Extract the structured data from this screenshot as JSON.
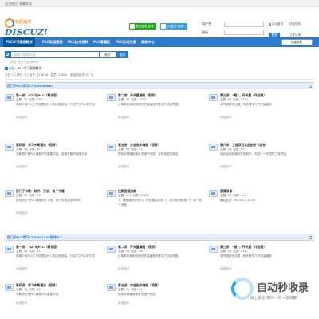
{
  "topbar": {
    "home_link": "设为首页",
    "fav_link": "收藏本站"
  },
  "logo": {
    "name": "社区动力",
    "brand": "DISCUZ!"
  },
  "quick_login": {
    "wechat": "微信登录 登录",
    "qq": "QQ账号 登录"
  },
  "login": {
    "username_label": "用户名",
    "password_label": "密码",
    "auto_login": "自动登录",
    "find_password": "找回密码",
    "login_button": "登录",
    "register": "立即注册"
  },
  "nav": {
    "items": [
      "PLC学习视频教学",
      "PLC实用案例",
      "PLC技术资料",
      "PLC答疑区",
      "PLC论坛交流",
      "帮助中心"
    ],
    "quick_nav": "快捷导航"
  },
  "search": {
    "placeholder": "请输入搜索内容",
    "scope": "帖子",
    "button": "搜索",
    "hot": "热搜: 活动 交友 discuz"
  },
  "breadcrumb": "论坛 › PLC学习视频教学",
  "stats": "今日: 0 | 昨日: 0 | 帖子: 118028 | 会员: 12602 | 欢迎新会员: fu 飞",
  "sections": [
    {
      "title": "西门子PLC学习S7-200/SMART",
      "forums": [
        {
          "name": "第一讲：“以”站PLC（精讲版）",
          "stats": "主题: 32, 帖数: 376",
          "desc": "简单介绍PLC工作原理及PLC的应用领域，介绍学习PLC的方法",
          "mod": "私密板块"
        },
        {
          "name": "第二讲：开关量编程（视频）",
          "stats": "主题: 38, 帖数: 1553",
          "desc": "以简单的案例说明开关量编程的基本方法及思路",
          "mod": "私密板块"
        },
        {
          "name": "第三讲：“看”，开关量（作业题）",
          "stats": "主题: 81, 帖数: 5517",
          "desc": "本节课做作业题，有步骤学习开关量编程",
          "mod": "私密板块"
        },
        {
          "name": "第四讲：学习中断理论（视频）",
          "stats": "主题: 33, 帖数: 31",
          "desc": "中断理论是PLC编程中的重要内容，讲解中断的使用方法",
          "mod": "私密板块"
        },
        {
          "name": "第五讲：步进指令编程（视频）",
          "stats": "主题: 36, 帖数: 47",
          "desc": "把多步骤编程用步进指令完成，让程序更加简洁",
          "mod": "私密板块"
        },
        {
          "name": "第六讲：工程项目实战剖析（综合）",
          "stats": "主题: 33, 帖数: 90",
          "desc": "综合运用前面所学的知识，完成一个完整的工程项目",
          "mod": "私密板块"
        },
        {
          "name": "西门子参数：软件、手册、电子书籍",
          "stats": "主题: 42, 帖数: 491",
          "desc": "提供西门子PLC编程软件下载、用户手册及技术资料",
          "mod": "私密板块"
        },
        {
          "name": "往期答疑指南",
          "stats": "主题: 471, 帖数: 1003",
          "desc": "1、请跟随老师学习，可在课后提问; 2、提问前请搜索; 3、每一帖一问题",
          "mod": ""
        },
        {
          "name": "直播录像",
          "stats": "主题: 37, 帖数: 124",
          "desc": "最后发表: 2024-8-4 13:50",
          "mod": ""
        }
      ]
    },
    {
      "title": "西门子PLC学习S7-300/1200系列PLC",
      "forums": [
        {
          "name": "第一讲：“以”站PLC（精讲版）",
          "stats": "主题: 36, 帖数: 31",
          "desc": "简单介绍PLC工作原理及PLC的应用领域，介绍学习PLC的方法",
          "mod": "私密板块"
        },
        {
          "name": "第二讲：开关量编程（视频）",
          "stats": "主题: 36, 帖数: 48",
          "desc": "以简单的案例说明开关量编程的基本方法及思路",
          "mod": "私密板块"
        },
        {
          "name": "第三讲：“看”，开关量（作业题）",
          "stats": "主题: 40, 帖数: 5517",
          "desc": "本节课做作业题，有步骤学习开关量编程",
          "mod": "私密板块"
        },
        {
          "name": "第四讲：学习中断理论（视频）",
          "stats": "主题: 36, 帖数: 32",
          "desc": "中断理论是PLC编程中的重要内容",
          "mod": "私密板块"
        },
        {
          "name": "第五讲：步进指令编程（视频）",
          "stats": "主题: 36, 帖数: 31",
          "desc": "把多步骤编程用步进指令完成",
          "mod": "私密板块"
        }
      ]
    }
  ],
  "watermark": {
    "title": "自动秒收录",
    "subtitle": "做上排名 来只一次 一路白霸"
  }
}
